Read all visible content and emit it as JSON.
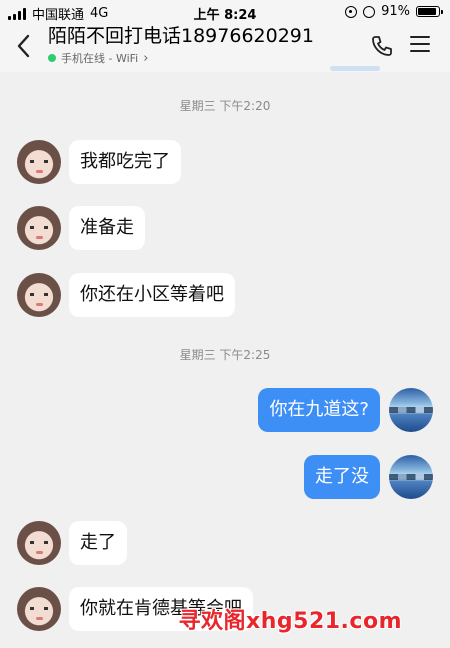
{
  "status_bar": {
    "carrier": "中国联通",
    "network": "4G",
    "time": "上午 8:24",
    "battery": "91%",
    "battery_level": 0.91
  },
  "header": {
    "title": "陌陌不回打电话18976620291",
    "status": "手机在线 - WiFi",
    "status_chevron": "›"
  },
  "messages": [
    {
      "type": "time",
      "text": "星期三 下午2:20"
    },
    {
      "type": "in",
      "text": "我都吃完了",
      "avatar": "woman-avatar"
    },
    {
      "type": "in",
      "text": "准备走",
      "avatar": "woman-avatar"
    },
    {
      "type": "in",
      "text": "你还在小区等着吧",
      "avatar": "woman-avatar"
    },
    {
      "type": "time",
      "text": "星期三 下午2:25"
    },
    {
      "type": "out",
      "text": "你在九道这?",
      "avatar": "lake-avatar"
    },
    {
      "type": "out",
      "text": "走了没",
      "avatar": "lake-avatar"
    },
    {
      "type": "in",
      "text": "走了",
      "avatar": "woman-avatar"
    },
    {
      "type": "in",
      "text": "你就在肯德基等会吧",
      "avatar": "woman-avatar"
    }
  ],
  "watermark": "寻欢阁xhg521.com",
  "colors": {
    "outgoing_bubble": "#3d8ef5",
    "incoming_bubble": "#ffffff",
    "background": "#f0f0f0",
    "online_dot": "#2ecc71",
    "watermark": "#e8262c"
  }
}
